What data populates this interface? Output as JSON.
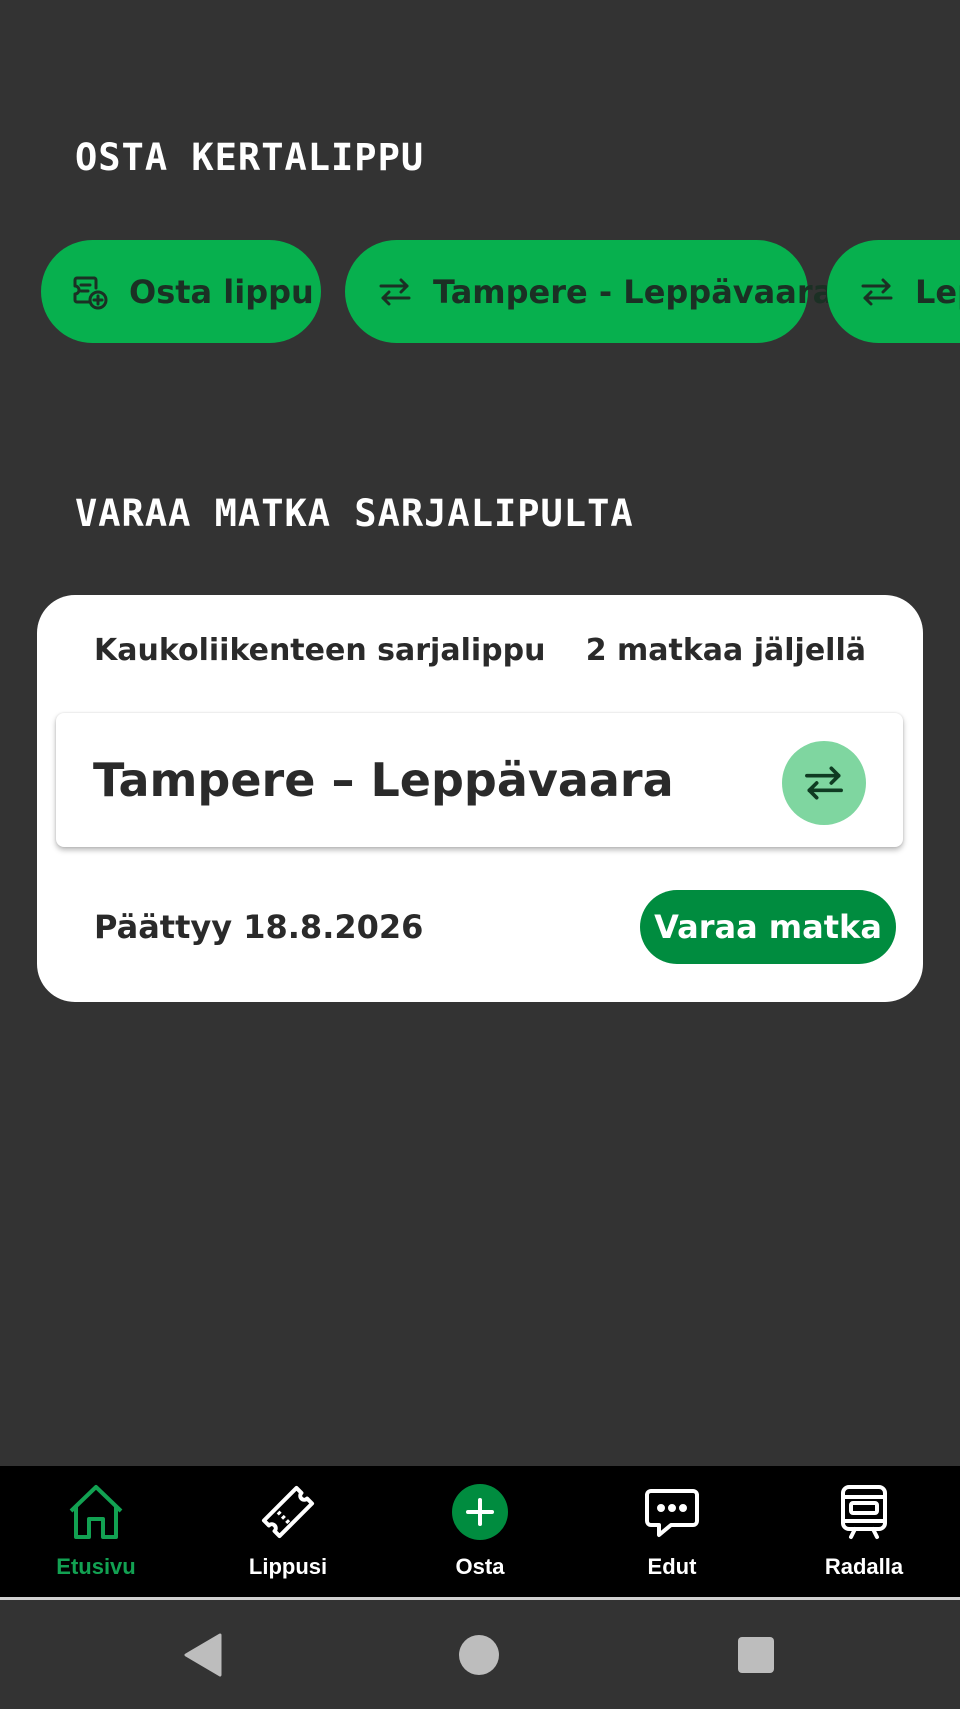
{
  "sections": {
    "single_ticket_title": "OSTA KERTALIPPU",
    "series_ticket_title": "VARAA MATKA SARJALIPULTA"
  },
  "chips": [
    {
      "label": "Osta lippu",
      "icon": "ticket-add-icon"
    },
    {
      "label": "Tampere - Leppävaara",
      "icon": "swap-arrows-icon"
    },
    {
      "label": "Leppävaara - Tampere",
      "icon": "swap-arrows-icon"
    }
  ],
  "series_card": {
    "ticket_name": "Kaukoliikenteen sarjalippu",
    "trips_left": "2 matkaa jäljellä",
    "route": "Tampere – Leppävaara",
    "expiry": "Päättyy 18.8.2026",
    "book_button": "Varaa matka"
  },
  "bottom_nav": [
    {
      "label": "Etusivu",
      "icon": "home-icon",
      "active": true
    },
    {
      "label": "Lippusi",
      "icon": "ticket-icon",
      "active": false
    },
    {
      "label": "Osta",
      "icon": "plus-circle-icon",
      "active": false
    },
    {
      "label": "Edut",
      "icon": "chat-icon",
      "active": false
    },
    {
      "label": "Radalla",
      "icon": "train-icon",
      "active": false
    }
  ],
  "colors": {
    "background": "#333333",
    "chip_green": "#07b04e",
    "primary_green": "#008c3f",
    "active_nav": "#12a152",
    "swap_button": "#7fd6a0"
  }
}
